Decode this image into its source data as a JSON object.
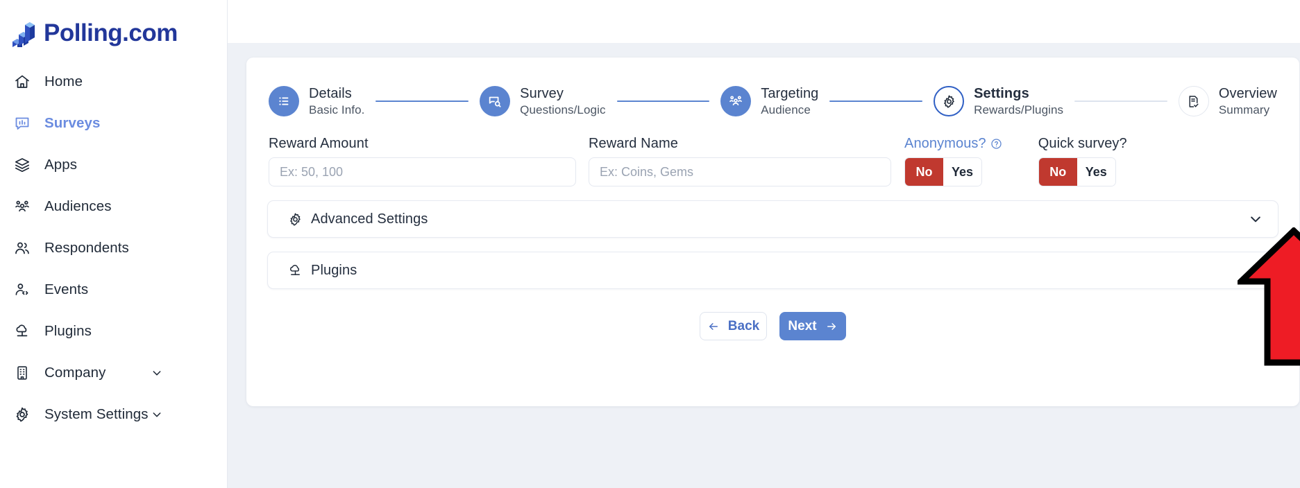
{
  "brand": {
    "name": "Polling.com",
    "logo_icon": "bar-chart-logo-icon"
  },
  "sidebar": {
    "items": [
      {
        "label": "Home",
        "icon": "home-icon",
        "active": false,
        "expandable": false
      },
      {
        "label": "Surveys",
        "icon": "survey-chart-icon",
        "active": true,
        "expandable": false
      },
      {
        "label": "Apps",
        "icon": "layers-icon",
        "active": false,
        "expandable": false
      },
      {
        "label": "Audiences",
        "icon": "audience-group-icon",
        "active": false,
        "expandable": false
      },
      {
        "label": "Respondents",
        "icon": "users-icon",
        "active": false,
        "expandable": false
      },
      {
        "label": "Events",
        "icon": "user-code-icon",
        "active": false,
        "expandable": false
      },
      {
        "label": "Plugins",
        "icon": "plugin-cloud-icon",
        "active": false,
        "expandable": false
      },
      {
        "label": "Company",
        "icon": "building-icon",
        "active": false,
        "expandable": true
      },
      {
        "label": "System Settings",
        "icon": "gear-icon",
        "active": false,
        "expandable": true
      }
    ]
  },
  "stepper": {
    "steps": [
      {
        "title": "Details",
        "subtitle": "Basic Info.",
        "icon": "list-icon",
        "state": "done"
      },
      {
        "title": "Survey",
        "subtitle": "Questions/Logic",
        "icon": "survey-search-icon",
        "state": "done"
      },
      {
        "title": "Targeting",
        "subtitle": "Audience",
        "icon": "audience-group-icon",
        "state": "done"
      },
      {
        "title": "Settings",
        "subtitle": "Rewards/Plugins",
        "icon": "gear-icon",
        "state": "current"
      },
      {
        "title": "Overview",
        "subtitle": "Summary",
        "icon": "document-check-icon",
        "state": "upcoming"
      }
    ]
  },
  "form": {
    "reward_amount": {
      "label": "Reward Amount",
      "placeholder": "Ex: 50, 100",
      "value": ""
    },
    "reward_name": {
      "label": "Reward Name",
      "placeholder": "Ex: Coins, Gems",
      "value": ""
    },
    "anonymous": {
      "label": "Anonymous?",
      "help_icon": "question-circle-icon",
      "options": [
        "No",
        "Yes"
      ],
      "selected": "No"
    },
    "quick_survey": {
      "label": "Quick survey?",
      "options": [
        "No",
        "Yes"
      ],
      "selected": "No"
    }
  },
  "accordions": [
    {
      "label": "Advanced Settings",
      "icon": "gear-icon",
      "chevron": "chevron-down-icon",
      "expanded": false
    },
    {
      "label": "Plugins",
      "icon": "plugin-cloud-icon",
      "chevron": "chevron-down-icon",
      "expanded": false
    }
  ],
  "actions": {
    "back": {
      "label": "Back",
      "icon": "arrow-left-icon"
    },
    "next": {
      "label": "Next",
      "icon": "arrow-right-icon"
    }
  },
  "annotation": {
    "type": "red-up-arrow",
    "points_at": "Anonymous? toggle",
    "fill_color": "#ee1c25",
    "stroke_color": "#000000"
  },
  "colors": {
    "brand_blue": "#22379a",
    "accent_blue": "#5b84d0",
    "active_nav": "#6b8ce0",
    "toggle_selected_red": "#c0392f",
    "page_background": "#eef1f6",
    "card_background": "#ffffff"
  }
}
